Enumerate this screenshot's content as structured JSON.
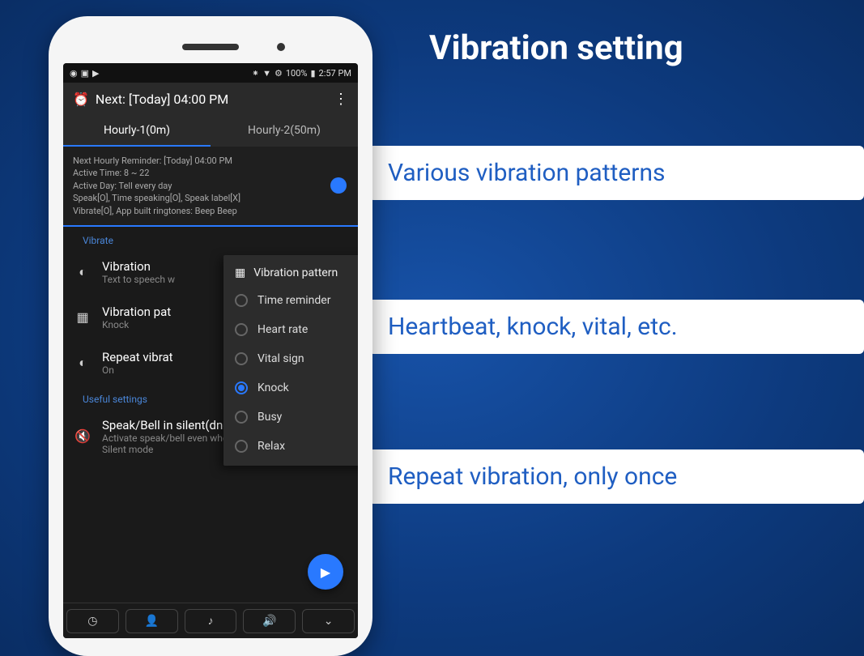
{
  "page_title": "Vibration setting",
  "features": [
    "Various vibration patterns",
    "Heartbeat, knock, vital, etc.",
    "Repeat vibration, only once"
  ],
  "status_bar": {
    "battery": "100%",
    "time": "2:57 PM"
  },
  "app": {
    "header": "Next: [Today] 04:00 PM",
    "tabs": [
      {
        "label": "Hourly-1(0m)",
        "active": true
      },
      {
        "label": "Hourly-2(50m)",
        "active": false
      }
    ],
    "info": {
      "line1": "Next Hourly Reminder: [Today] 04:00 PM",
      "line2": "Active Time: 8 ~ 22",
      "line3": "Active Day: Tell every day",
      "line4": "Speak[O], Time speaking[O], Speak label[X]",
      "line5": "Vibrate[O], App built ringtones: Beep Beep"
    },
    "sections": {
      "vibrate_label": "Vibrate",
      "useful_label": "Useful settings"
    },
    "settings": {
      "vibration": {
        "title": "Vibration",
        "sub": "Text to speech w"
      },
      "pattern": {
        "title": "Vibration pat",
        "sub": "Knock"
      },
      "repeat": {
        "title": "Repeat vibrat",
        "sub": "On"
      },
      "silent": {
        "title": "Speak/Bell in silent(dnd) mode",
        "sub": "Activate speak/bell even when the device is in Silent mode"
      }
    },
    "popup": {
      "header": "Vibration pattern",
      "options": [
        "Time reminder",
        "Heart rate",
        "Vital sign",
        "Knock",
        "Busy",
        "Relax"
      ],
      "selected": "Knock"
    }
  }
}
